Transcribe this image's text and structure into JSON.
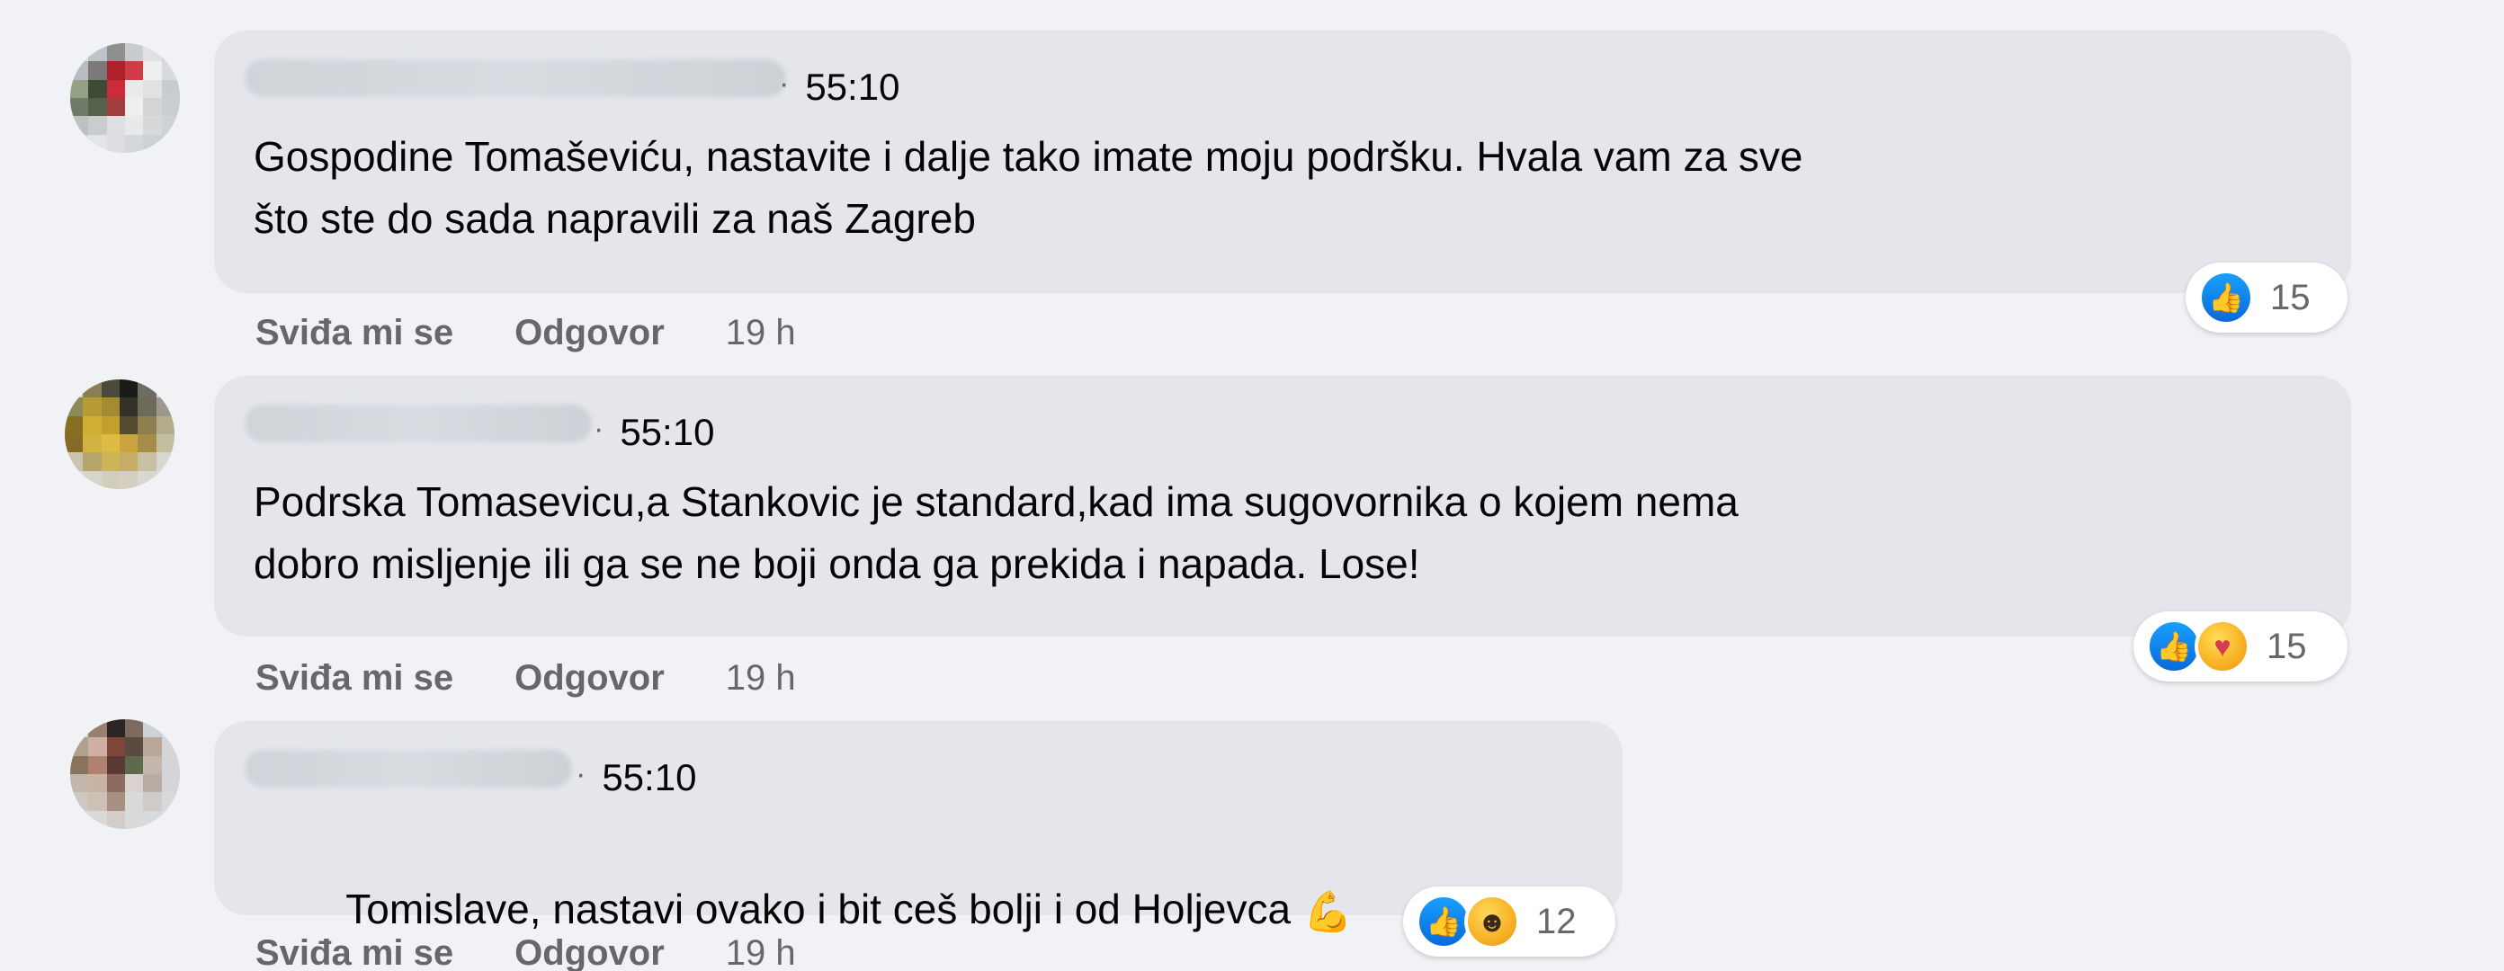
{
  "comments": [
    {
      "timestamp": "55:10",
      "text": "Gospodine Tomaševiću, nastavite i dalje tako imate moju podršku. Hvala vam za sve\nšto ste do sada napravili za naš Zagreb",
      "actions": {
        "like_label": "Sviđa mi se",
        "reply_label": "Odgovor",
        "time_ago": "19 h"
      },
      "reaction_count": "15",
      "reaction_icons": [
        "like"
      ]
    },
    {
      "timestamp": "55:10",
      "text": "Podrska Tomasevicu,a Stankovic je standard,kad ima sugovornika o kojem nema\ndobro misljenje ili ga se ne boji onda ga prekida i napada. Lose!",
      "actions": {
        "like_label": "Sviđa mi se",
        "reply_label": "Odgovor",
        "time_ago": "19 h"
      },
      "reaction_count": "15",
      "reaction_icons": [
        "like",
        "care"
      ]
    },
    {
      "timestamp": "55:10",
      "text": "Tomislave, nastavi ovako i bit ceš bolji i od Holjevca",
      "emoji": "💪",
      "actions": {
        "like_label": "Sviđa mi se",
        "reply_label": "Odgovor",
        "time_ago": "19 h"
      },
      "reaction_count": "12",
      "reaction_icons": [
        "like",
        "haha"
      ]
    }
  ],
  "icons": {
    "like_icon": "like-icon",
    "care_icon": "care-icon",
    "haha_icon": "haha-icon",
    "muscle_icon": "flexed-biceps-icon"
  },
  "colors": {
    "bubble": "#e4e6eb",
    "background": "#f0f2f5",
    "secondary_text": "#65676b",
    "like_blue": "#1877f2"
  }
}
